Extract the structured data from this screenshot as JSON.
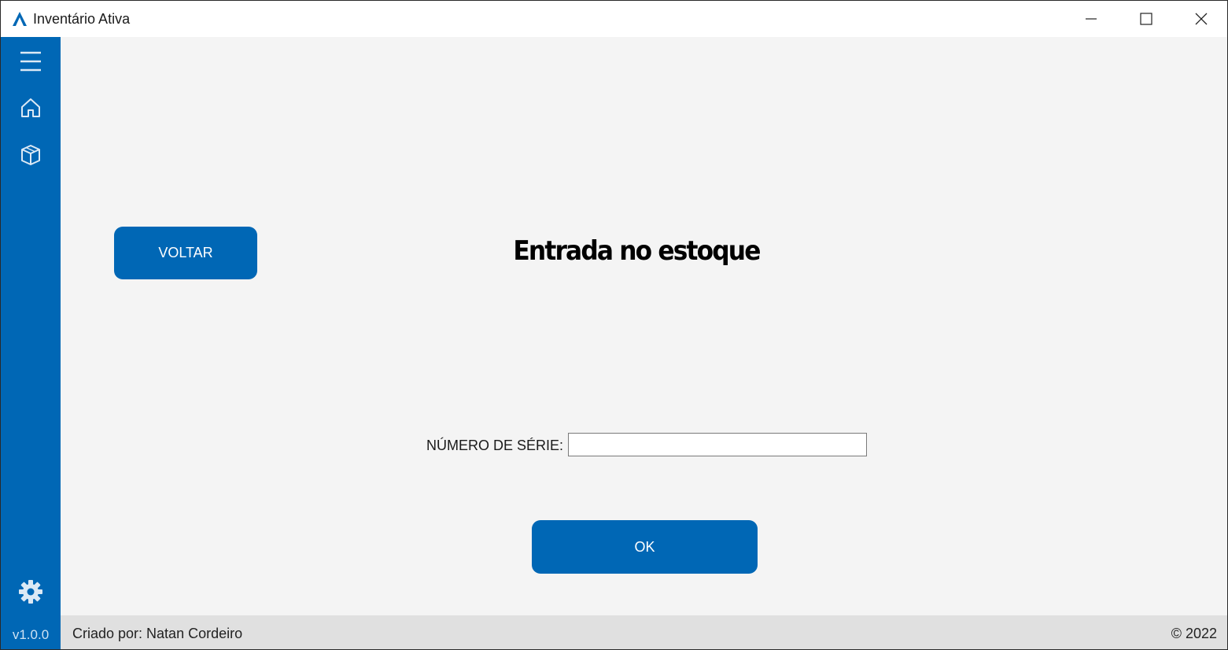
{
  "window": {
    "title": "Inventário Ativa"
  },
  "sidebar": {
    "items": [
      {
        "icon": "hamburger-menu-icon"
      },
      {
        "icon": "home-icon"
      },
      {
        "icon": "box-icon"
      },
      {
        "icon": "gear-icon"
      }
    ],
    "version": "v1.0.0"
  },
  "main": {
    "back_button_label": "VOLTAR",
    "page_title": "Entrada no estoque",
    "serial_label": "NÚMERO DE SÉRIE:",
    "serial_value": "",
    "serial_placeholder": "",
    "ok_button_label": "OK"
  },
  "footer": {
    "author": "Criado por: Natan Cordeiro",
    "copyright": "© 2022"
  },
  "colors": {
    "accent": "#0067b5",
    "background": "#f4f4f4",
    "footer_bg": "#e0e0e0",
    "titlebar_bg": "#ffffff"
  }
}
